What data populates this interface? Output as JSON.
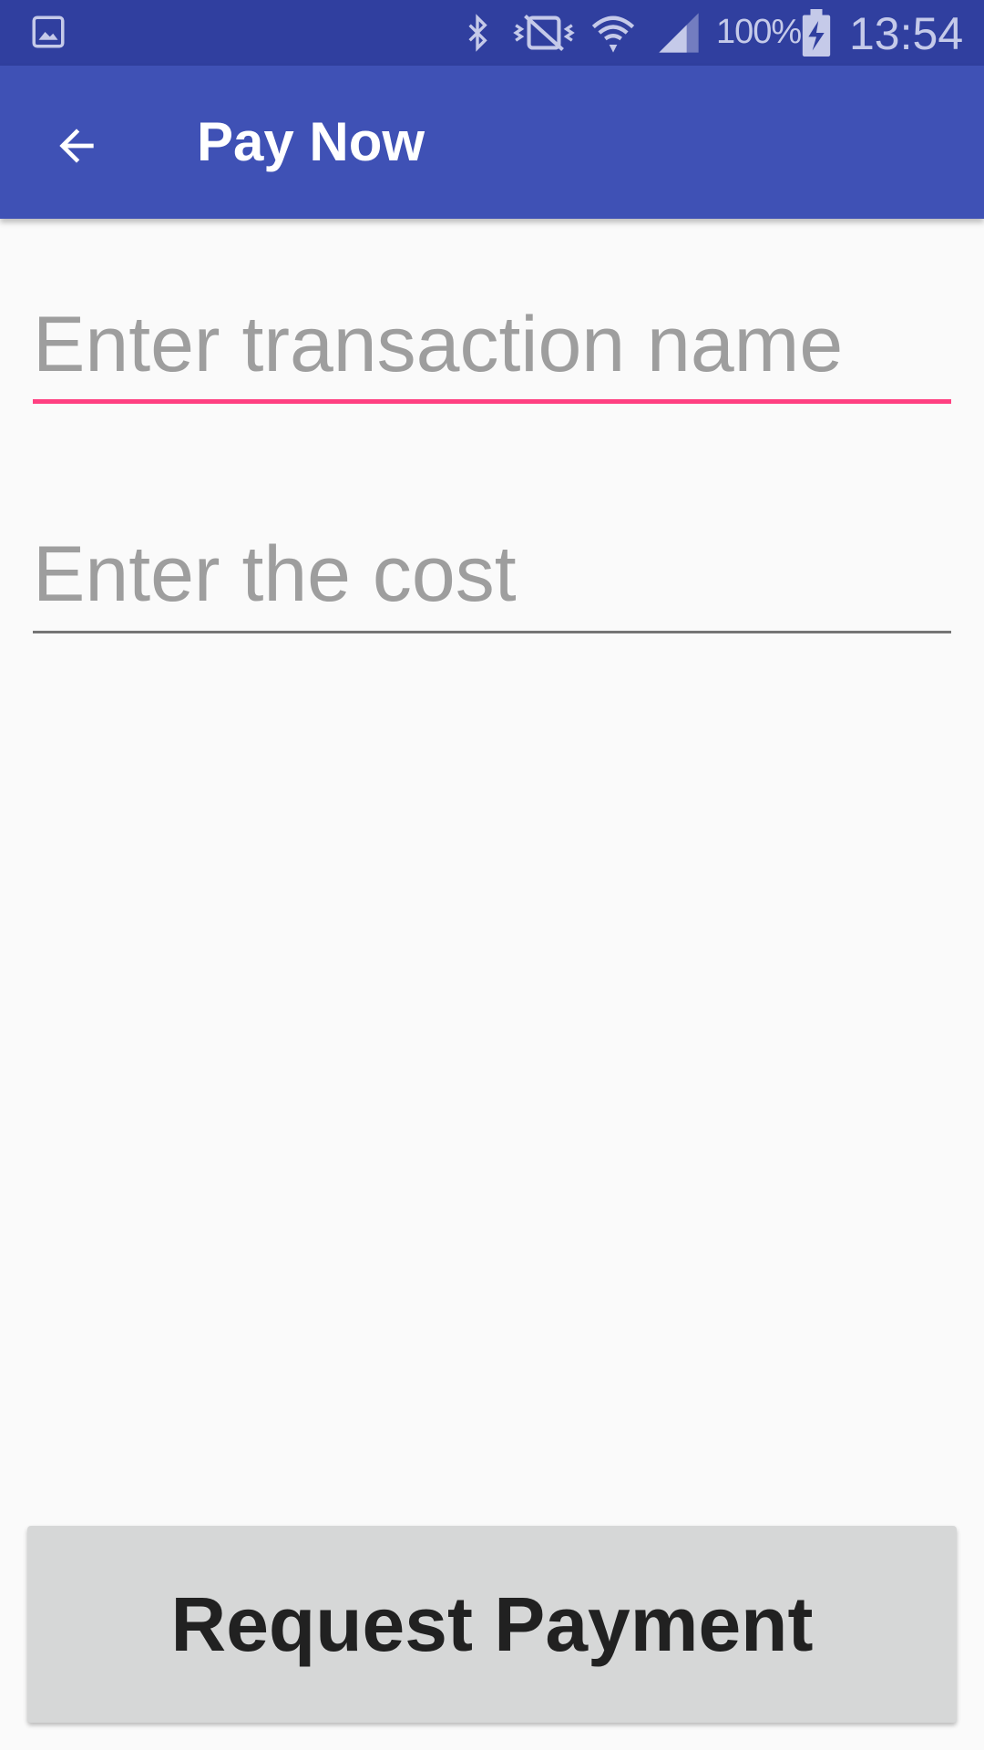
{
  "status_bar": {
    "battery_text": "100%",
    "clock": "13:54",
    "icons": [
      "gallery-icon",
      "bluetooth-icon",
      "vibrate-icon",
      "wifi-icon",
      "signal-icon",
      "battery-charging-icon"
    ]
  },
  "app_bar": {
    "title": "Pay Now",
    "back_icon": "arrow-back-icon",
    "color": "#3F51B5"
  },
  "form": {
    "transaction_name": {
      "value": "",
      "placeholder": "Enter transaction name",
      "accent_color": "#FF4081"
    },
    "cost": {
      "value": "",
      "placeholder": "Enter the cost"
    }
  },
  "actions": {
    "request_payment_label": "Request Payment"
  },
  "colors": {
    "status_bar": "#303F9F",
    "primary": "#3F51B5",
    "accent": "#FF4081",
    "background": "#FAFAFA",
    "button": "#D6D7D7"
  }
}
